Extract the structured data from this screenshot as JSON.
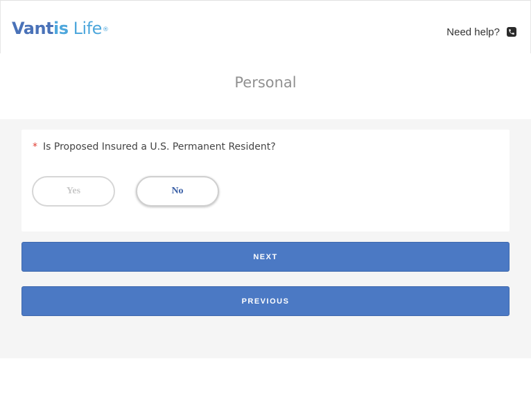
{
  "header": {
    "logo": {
      "part1": "Vant",
      "part2": "is",
      "part3": " Life",
      "reg": "®"
    },
    "help_label": "Need help?"
  },
  "page": {
    "title": "Personal"
  },
  "question": {
    "required_marker": "*",
    "text": "Is Proposed Insured a U.S. Permanent Resident?",
    "options": [
      {
        "label": "Yes"
      },
      {
        "label": "No"
      }
    ]
  },
  "buttons": {
    "next_label": "NEXT",
    "previous_label": "PREVIOUS"
  },
  "colors": {
    "brand_blue": "#4a72b8",
    "brand_light_blue": "#4ea7dc",
    "button_blue": "#4b79c4",
    "required_red": "#e03c31"
  }
}
